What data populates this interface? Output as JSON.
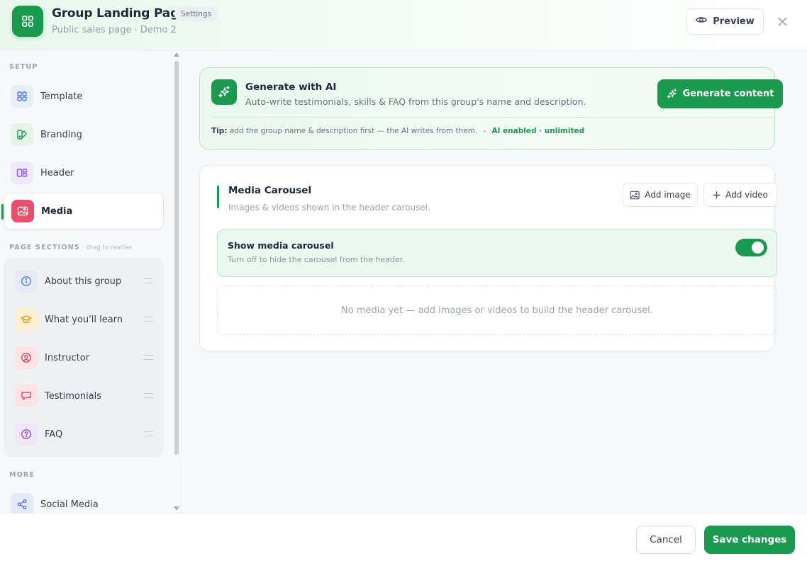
{
  "header": {
    "title": "Group Landing Page",
    "badge": "Settings",
    "subtitle": "Public sales page · Demo 2",
    "preview_label": "Preview",
    "app_icon": "grid-icon",
    "close_icon": "close-icon"
  },
  "sidebar": {
    "setup_label": "SETUP",
    "setup_items": [
      {
        "label": "Template",
        "icon": "grid-icon"
      },
      {
        "label": "Branding",
        "icon": "palette-icon"
      },
      {
        "label": "Header",
        "icon": "layout-icon"
      },
      {
        "label": "Media",
        "icon": "image-icon",
        "active": true
      }
    ],
    "sections_label": "PAGE SECTIONS",
    "sections_hint": "· drag to reorder",
    "sections": [
      {
        "label": "About this group",
        "icon": "info-icon"
      },
      {
        "label": "What you'll learn",
        "icon": "graduation-cap-icon"
      },
      {
        "label": "Instructor",
        "icon": "user-icon"
      },
      {
        "label": "Testimonials",
        "icon": "chat-icon"
      },
      {
        "label": "FAQ",
        "icon": "question-icon"
      }
    ],
    "more_label": "MORE",
    "more_items": [
      {
        "label": "Social Media",
        "icon": "share-icon"
      }
    ]
  },
  "ai_card": {
    "title": "Generate with AI",
    "description": "Auto-write testimonials, skills & FAQ from this group's name and description.",
    "button_label": "Generate content",
    "tip_label": "Tip:",
    "tip_text": "add the group name & description first — the AI writes from them.",
    "status": "AI enabled · unlimited"
  },
  "media_card": {
    "title": "Media Carousel",
    "description": "Images & videos shown in the header carousel.",
    "add_image_label": "Add image",
    "add_video_label": "Add video",
    "toggle_title": "Show media carousel",
    "toggle_description": "Turn off to hide the carousel from the header.",
    "toggle_on": true,
    "empty_text": "No media yet — add images or videos to build the header carousel."
  },
  "footer": {
    "cancel_label": "Cancel",
    "save_label": "Save changes"
  },
  "colors": {
    "accent": "#1a9a4f",
    "accent_light": "#ebf8ef",
    "border": "#e6e9ec"
  }
}
